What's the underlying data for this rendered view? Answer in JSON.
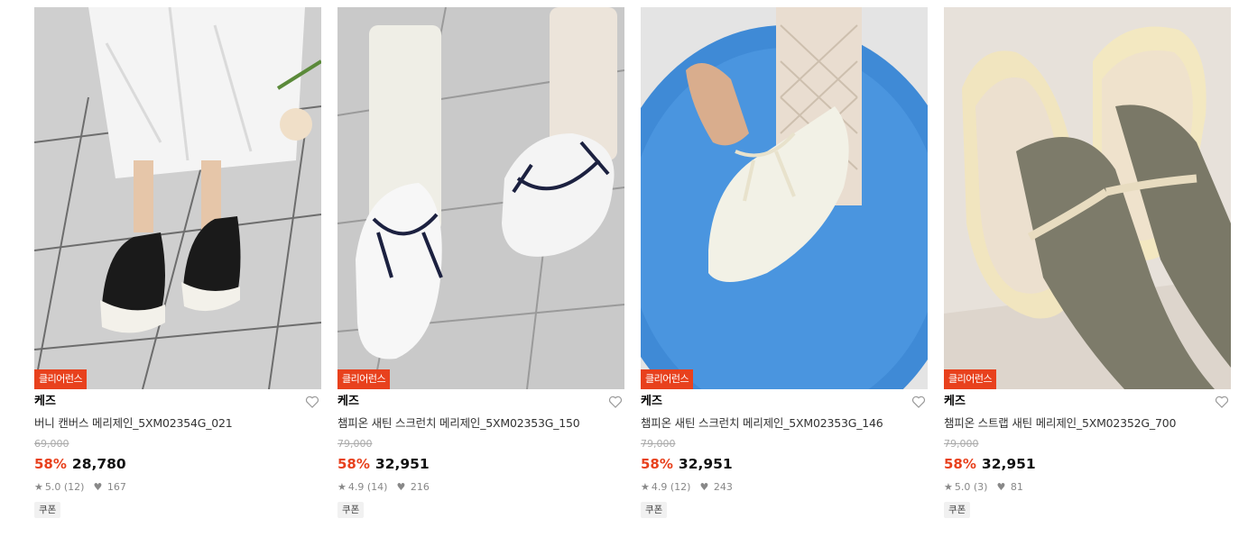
{
  "products": [
    {
      "badge": "클리어런스",
      "brand": "케즈",
      "name": "버니 캔버스 메리제인_5XM02354G_021",
      "original_price": "69,000",
      "discount": "58%",
      "price": "28,780",
      "rating": "5.0",
      "reviews": "(12)",
      "likes": "167",
      "coupon": "쿠폰"
    },
    {
      "badge": "클리어런스",
      "brand": "케즈",
      "name": "챔피온 새틴 스크런치 메리제인_5XM02353G_150",
      "original_price": "79,000",
      "discount": "58%",
      "price": "32,951",
      "rating": "4.9",
      "reviews": "(14)",
      "likes": "216",
      "coupon": "쿠폰"
    },
    {
      "badge": "클리어런스",
      "brand": "케즈",
      "name": "챔피온 새틴 스크런치 메리제인_5XM02353G_146",
      "original_price": "79,000",
      "discount": "58%",
      "price": "32,951",
      "rating": "4.9",
      "reviews": "(12)",
      "likes": "243",
      "coupon": "쿠폰"
    },
    {
      "badge": "클리어런스",
      "brand": "케즈",
      "name": "챔피온 스트랩 새틴 메리제인_5XM02352G_700",
      "original_price": "79,000",
      "discount": "58%",
      "price": "32,951",
      "rating": "5.0",
      "reviews": "(3)",
      "likes": "81",
      "coupon": "쿠폰"
    }
  ],
  "colors": {
    "badge_bg": "#e8411d",
    "discount": "#e8411d"
  },
  "icons": {
    "wishlist": "heart-outline-icon",
    "rating": "star-icon",
    "likes": "heart-filled-icon"
  }
}
